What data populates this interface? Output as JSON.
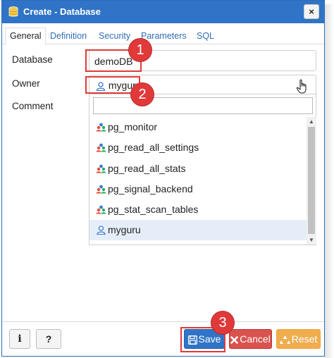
{
  "window": {
    "title": "Create - Database",
    "close_label": "×"
  },
  "tabs": [
    {
      "label": "General",
      "active": true
    },
    {
      "label": "Definition",
      "active": false
    },
    {
      "label": "Security",
      "active": false
    },
    {
      "label": "Parameters",
      "active": false
    },
    {
      "label": "SQL",
      "active": false
    }
  ],
  "form": {
    "database_label": "Database",
    "database_value": "demoDB",
    "owner_label": "Owner",
    "owner_value": "myguru",
    "comment_label": "Comment"
  },
  "dropdown": {
    "search_value": "",
    "items": [
      {
        "label": "pg_monitor",
        "icon": "group-role-icon",
        "selected": false
      },
      {
        "label": "pg_read_all_settings",
        "icon": "group-role-icon",
        "selected": false
      },
      {
        "label": "pg_read_all_stats",
        "icon": "group-role-icon",
        "selected": false
      },
      {
        "label": "pg_signal_backend",
        "icon": "group-role-icon",
        "selected": false
      },
      {
        "label": "pg_stat_scan_tables",
        "icon": "group-role-icon",
        "selected": false
      },
      {
        "label": "myguru",
        "icon": "user-role-icon",
        "selected": true
      }
    ]
  },
  "footer": {
    "info_label": "i",
    "help_label": "?",
    "save_label": "Save",
    "cancel_label": "Cancel",
    "reset_label": "Reset"
  },
  "callouts": {
    "one": "1",
    "two": "2",
    "three": "3"
  },
  "colors": {
    "title_bar": "#2f74c6",
    "link_tab": "#2f6db5",
    "save": "#2f74c6",
    "cancel": "#d9534f",
    "reset": "#f0ad4e",
    "callout": "#e0393a",
    "selected_item": "#e5eef8"
  }
}
